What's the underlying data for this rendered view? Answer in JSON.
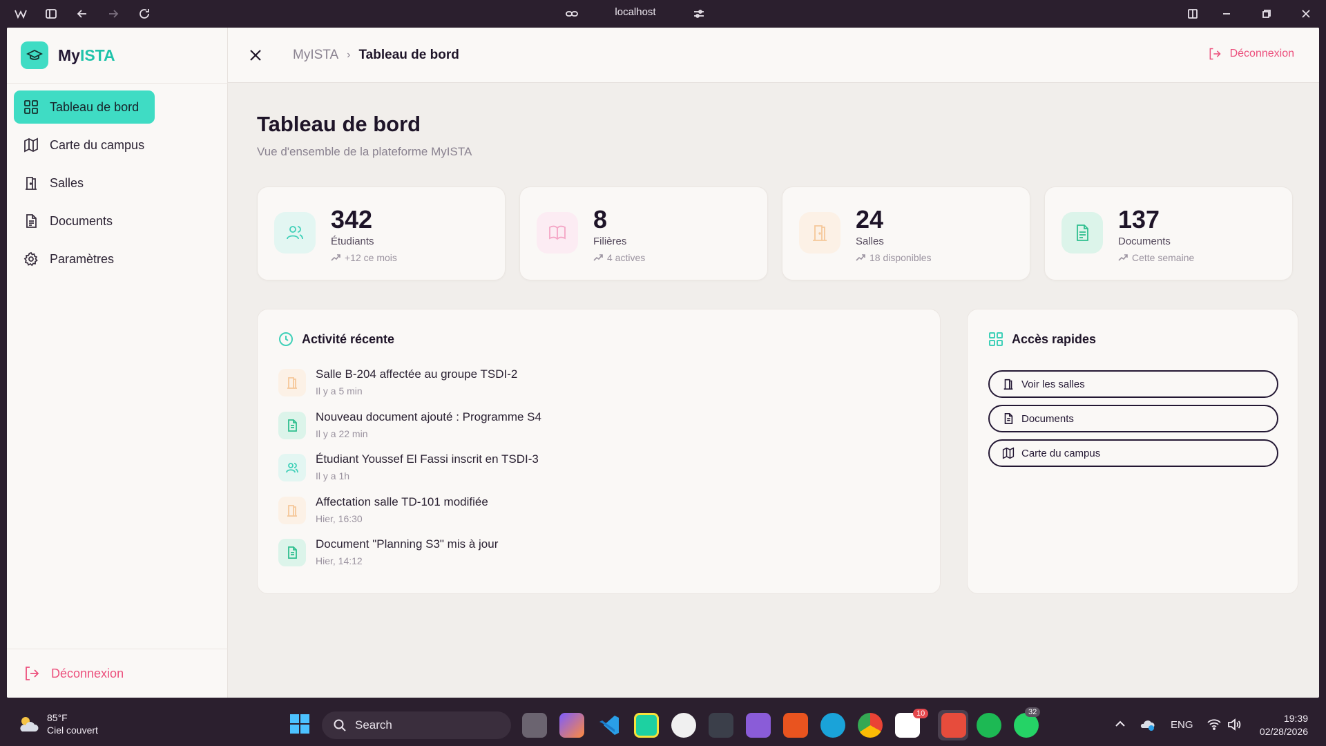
{
  "browser": {
    "url": "localhost"
  },
  "brand": {
    "prefix": "My",
    "accent": "ISTA",
    "accent_color": "#20c3aa"
  },
  "sidebar": {
    "items": [
      {
        "label": "Tableau de bord",
        "icon": "dashboard-grid-icon",
        "active": true
      },
      {
        "label": "Carte du campus",
        "icon": "map-icon",
        "active": false
      },
      {
        "label": "Salles",
        "icon": "door-icon",
        "active": false
      },
      {
        "label": "Documents",
        "icon": "document-icon",
        "active": false
      },
      {
        "label": "Paramètres",
        "icon": "gear-icon",
        "active": false
      }
    ],
    "logout_label": "Déconnexion"
  },
  "topbar": {
    "breadcrumb_root": "MyISTA",
    "breadcrumb_current": "Tableau de bord",
    "logout_label": "Déconnexion"
  },
  "page": {
    "title": "Tableau de bord",
    "subtitle": "Vue d'ensemble de la plateforme MyISTA"
  },
  "stats": [
    {
      "value": "342",
      "label": "Étudiants",
      "trend": "+12 ce mois",
      "icon": "users-icon",
      "color": "#3fd0b8"
    },
    {
      "value": "8",
      "label": "Filières",
      "trend": "4 actives",
      "icon": "book-icon",
      "color": "#f4a6c6"
    },
    {
      "value": "24",
      "label": "Salles",
      "trend": "18 disponibles",
      "icon": "door-icon",
      "color": "#f5c89a"
    },
    {
      "value": "137",
      "label": "Documents",
      "trend": "Cette semaine",
      "icon": "document-icon",
      "color": "#2fbf8f"
    }
  ],
  "activity": {
    "title": "Activité récente",
    "items": [
      {
        "title": "Salle B-204 affectée au groupe TSDI-2",
        "time": "Il y a 5 min",
        "icon": "door-icon"
      },
      {
        "title": "Nouveau document ajouté : Programme S4",
        "time": "Il y a 22 min",
        "icon": "document-icon"
      },
      {
        "title": "Étudiant Youssef El Fassi inscrit en TSDI-3",
        "time": "Il y a 1h",
        "icon": "users-icon"
      },
      {
        "title": "Affectation salle TD-101 modifiée",
        "time": "Hier, 16:30",
        "icon": "door-icon"
      },
      {
        "title": "Document \"Planning S3\" mis à jour",
        "time": "Hier, 14:12",
        "icon": "document-icon"
      }
    ]
  },
  "quick_access": {
    "title": "Accès rapides",
    "buttons": [
      {
        "label": "Voir les salles",
        "icon": "door-icon"
      },
      {
        "label": "Documents",
        "icon": "document-icon"
      },
      {
        "label": "Carte du campus",
        "icon": "map-icon"
      }
    ]
  },
  "taskbar": {
    "weather_temp": "85°F",
    "weather_desc": "Ciel couvert",
    "search_label": "Search",
    "language": "ENG",
    "time": "19:39",
    "date": "02/28/2026",
    "notion_badge": "10",
    "whatsapp_badge": "32"
  }
}
